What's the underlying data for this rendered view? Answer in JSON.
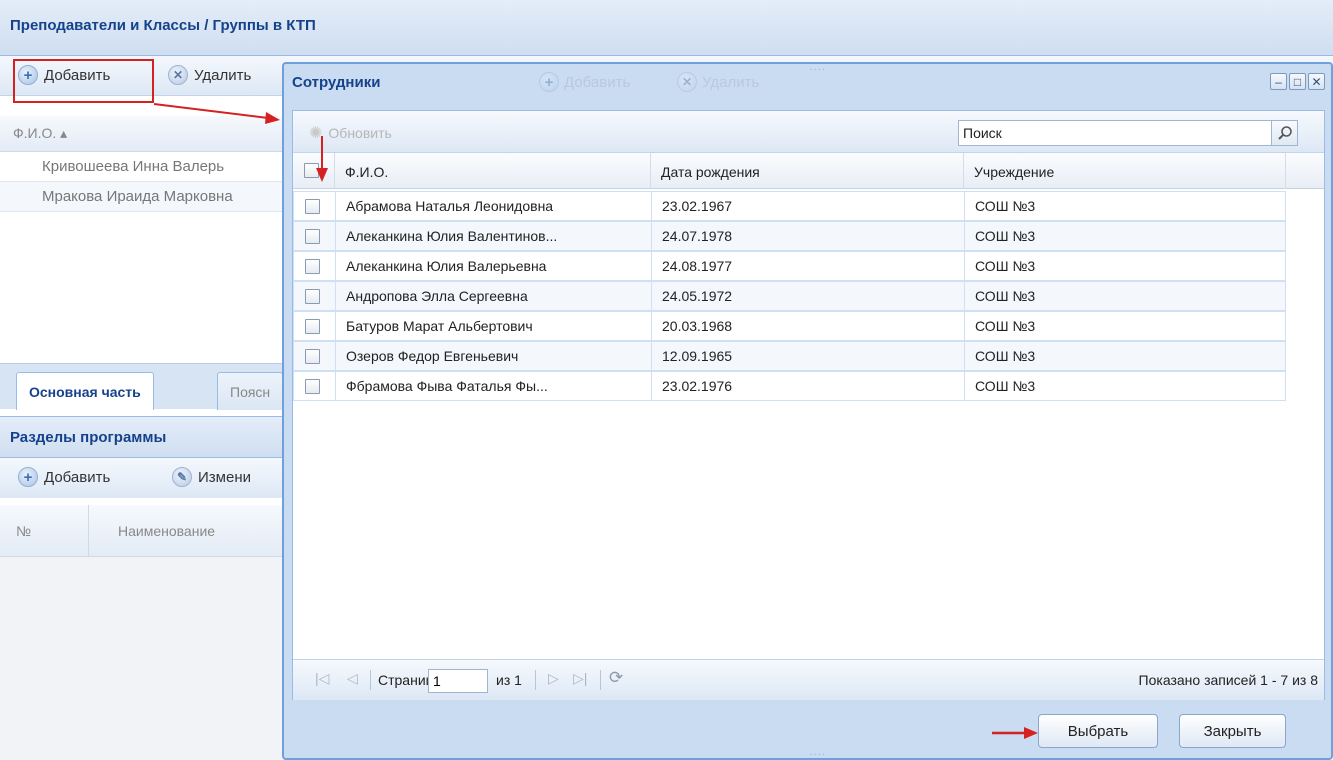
{
  "background": {
    "title": "Преподаватели и Классы / Группы в КТП",
    "toolbar": {
      "add_label": "Добавить",
      "delete_label": "Удалить"
    },
    "column_header": "Ф.И.О. ▴",
    "rows": [
      "Кривошеева Инна Валерь",
      "Мракова Ираида Марковна"
    ],
    "tabs": {
      "active": "Основная часть",
      "inactive": "Поясн"
    },
    "section_title": "Разделы программы",
    "toolbar2": {
      "add_label": "Добавить",
      "edit_label": "Измени"
    },
    "columns2": {
      "num": "№",
      "name": "Наименование"
    }
  },
  "dialog": {
    "title": "Сотрудники",
    "ghost_add": "Добавить",
    "ghost_delete": "Удалить",
    "refresh_label": "Обновить",
    "search_value": "Поиск",
    "columns": {
      "fio": "Ф.И.О.",
      "birth": "Дата рождения",
      "org": "Учреждение"
    },
    "rows": [
      {
        "fio": "Абрамова Наталья Леонидовна",
        "birth": "23.02.1967",
        "org": "СОШ №3"
      },
      {
        "fio": "Алеканкина Юлия Валентинов...",
        "birth": "24.07.1978",
        "org": "СОШ №3"
      },
      {
        "fio": "Алеканкина Юлия Валерьевна",
        "birth": "24.08.1977",
        "org": "СОШ №3"
      },
      {
        "fio": "Андропова Элла Сергеевна",
        "birth": "24.05.1972",
        "org": "СОШ №3"
      },
      {
        "fio": "Батуров Марат Альбертович",
        "birth": "20.03.1968",
        "org": "СОШ №3"
      },
      {
        "fio": "Озеров Федор Евгеньевич",
        "birth": "12.09.1965",
        "org": "СОШ №3"
      },
      {
        "fio": "Фбрамова Фыва Фаталья Фы...",
        "birth": "23.02.1976",
        "org": "СОШ №3"
      }
    ],
    "pager": {
      "page_label": "Страница",
      "page_value": "1",
      "of_label": "из 1",
      "summary": "Показано записей 1 - 7 из 8"
    },
    "buttons": {
      "select": "Выбрать",
      "close": "Закрыть"
    }
  },
  "colors": {
    "accent": "#15428b",
    "window_border": "#6fa0db",
    "annotation": "#d62121"
  }
}
